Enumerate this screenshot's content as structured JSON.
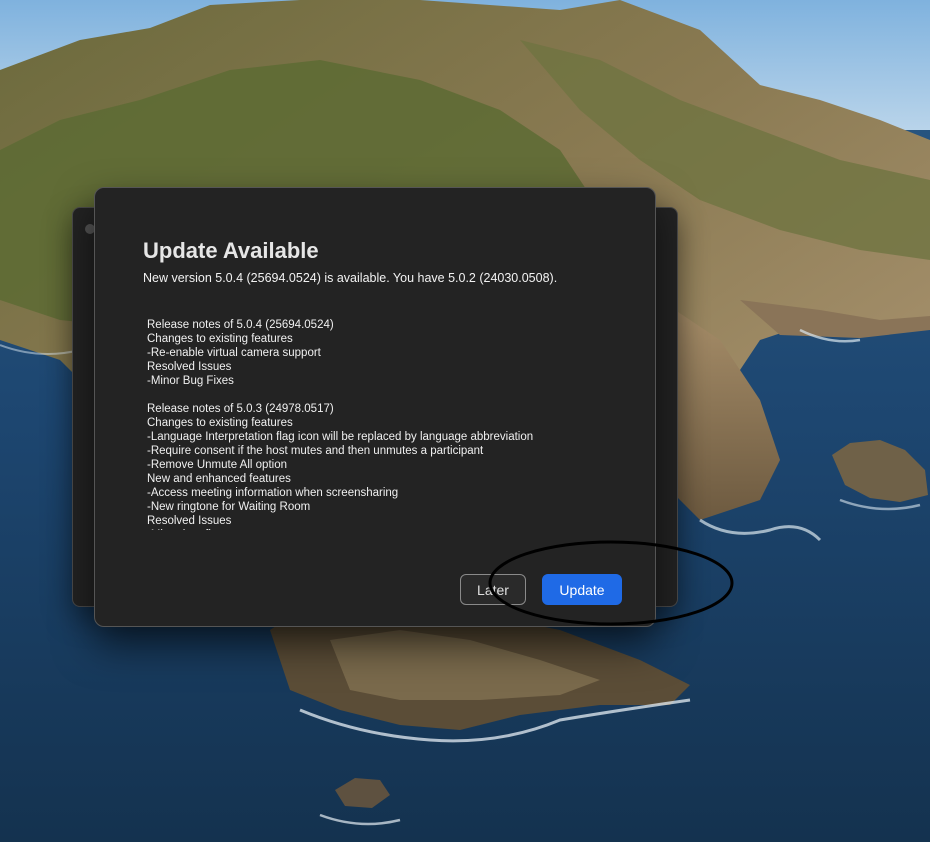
{
  "dialog": {
    "title": "Update Available",
    "subtitle": "New version 5.0.4 (25694.0524) is available. You have 5.0.2 (24030.0508).",
    "release_notes": [
      "Release notes of 5.0.4 (25694.0524)",
      "Changes to existing features",
      "-Re-enable virtual camera support",
      "Resolved Issues",
      "-Minor Bug Fixes",
      "",
      "Release notes of 5.0.3 (24978.0517)",
      "Changes to existing features",
      "-Language Interpretation flag icon will be replaced by language abbreviation",
      "-Require consent if the host mutes and then unmutes a participant",
      "-Remove Unmute All option",
      "New and enhanced features",
      "-Access meeting information when screensharing",
      "-New ringtone for Waiting Room",
      "Resolved Issues",
      "-Minor bug fixes"
    ],
    "buttons": {
      "later_label": "Later",
      "update_label": "Update"
    }
  },
  "colors": {
    "dialog_background": "#232323",
    "primary_button": "#1f6ae6",
    "annotation_ellipse": "#000000"
  }
}
